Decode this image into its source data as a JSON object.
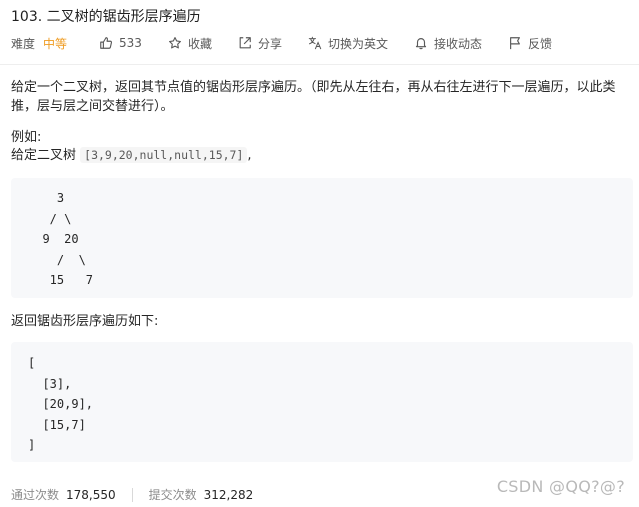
{
  "problem": {
    "title": "103. 二叉树的锯齿形层序遍历",
    "difficulty_label": "难度",
    "difficulty": "中等",
    "likes": "533",
    "favorite_label": "收藏",
    "share_label": "分享",
    "switch_lang_label": "切换为英文",
    "subscribe_label": "接收动态",
    "feedback_label": "反馈"
  },
  "description": {
    "text": "给定一个二叉树，返回其节点值的锯齿形层序遍历。（即先从左往右，再从右往左进行下一层遍历，以此类推，层与层之间交替进行）。",
    "example_label": "例如:",
    "given_prefix": "给定二叉树 ",
    "given_code": "[3,9,20,null,null,15,7]",
    "given_suffix": ",",
    "tree_ascii": "    3\n   / \\\n  9  20\n    /  \\\n   15   7",
    "return_label": "返回锯齿形层序遍历如下:",
    "result_ascii": "[\n  [3],\n  [20,9],\n  [15,7]\n]"
  },
  "stats": {
    "accepted_label": "通过次数",
    "accepted_value": "178,550",
    "submissions_label": "提交次数",
    "submissions_value": "312,282"
  },
  "watermark": "CSDN @QQ?@?",
  "icons": [
    "thumbs-up-icon",
    "star-icon",
    "share-icon",
    "translate-icon",
    "bell-icon",
    "flag-icon"
  ]
}
